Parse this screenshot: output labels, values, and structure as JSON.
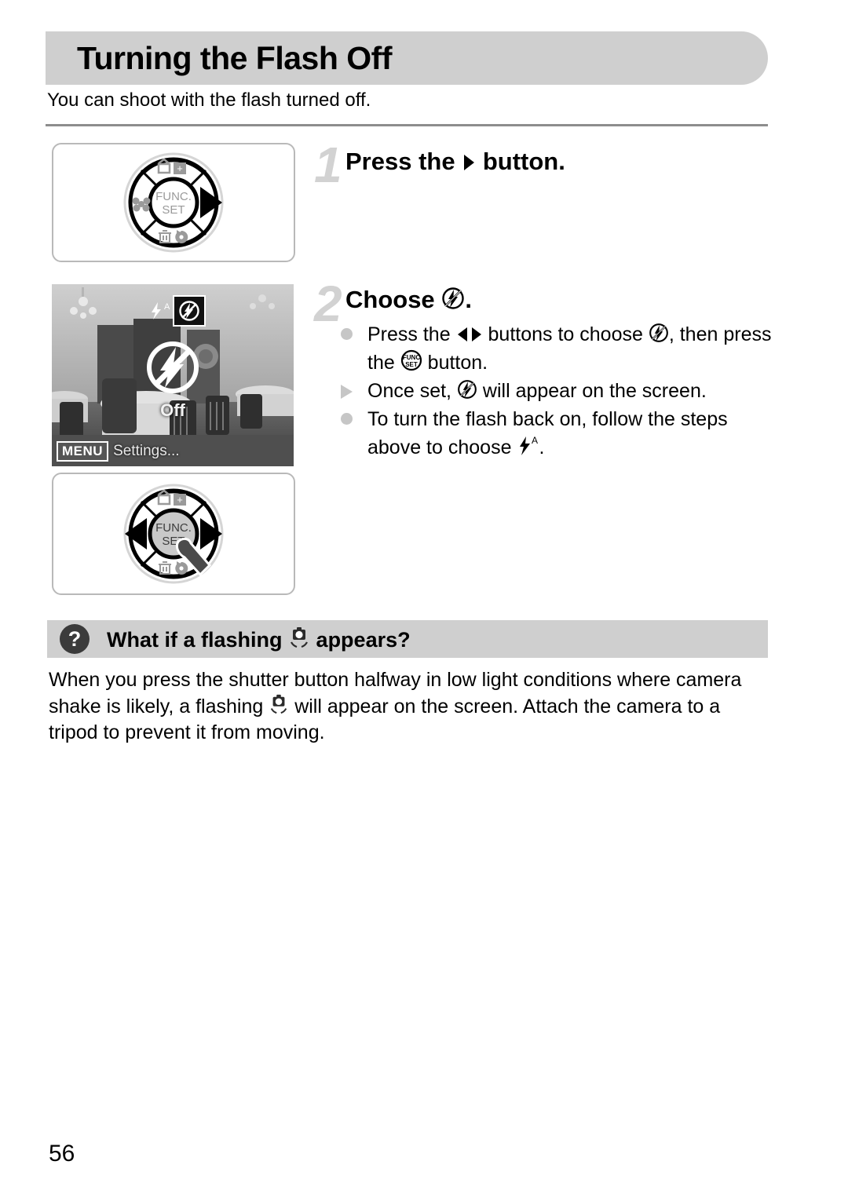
{
  "document": {
    "title": "Turning the Flash Off",
    "intro": "You can shoot with the flash turned off.",
    "page_number": "56"
  },
  "steps": [
    {
      "number": "1",
      "heading_before": "Press the",
      "heading_icon": "right-arrow-button-icon",
      "heading_after": "button."
    },
    {
      "number": "2",
      "heading_before": "Choose",
      "heading_icon": "flash-off-icon",
      "heading_after": "."
    }
  ],
  "bullets": [
    {
      "marker": "dot",
      "seg1": "Press the",
      "icon1": "left-right-buttons-icon",
      "seg2": "buttons to choose",
      "icon2": "flash-off-icon",
      "seg3": ", then press the",
      "icon3": "func-set-button-icon",
      "seg4": "button."
    },
    {
      "marker": "triangle",
      "seg1": "Once set,",
      "icon1": "flash-off-icon",
      "seg2": "will appear on the screen."
    },
    {
      "marker": "dot",
      "seg1": "To turn the flash back on, follow the steps above to choose",
      "icon1": "flash-auto-icon",
      "seg2": "."
    }
  ],
  "faq": {
    "question_mark": "?",
    "title_before": "What if a flashing",
    "title_icon": "camera-shake-icon",
    "title_after": "appears?",
    "body_before": "When you press the shutter button halfway in low light conditions where camera shake is likely, a flashing",
    "body_icon": "camera-shake-icon",
    "body_after": "will appear on the screen. Attach the camera to a tripod to prevent it from moving."
  },
  "illustrations": {
    "dial_one": {
      "name": "camera-control-dial-right-pressed",
      "center_label_top": "FUNC.",
      "center_label_bottom": "SET",
      "highlight": "right"
    },
    "dial_two": {
      "name": "camera-control-dial-left-right-pressed",
      "center_label_top": "FUNC.",
      "center_label_bottom": "SET",
      "highlight": "left-right"
    },
    "lcd": {
      "name": "camera-lcd-flash-off-selection",
      "option_auto": "flash-auto-icon",
      "option_off": "flash-off-icon",
      "status_label": "Off",
      "menu_chip": "MENU",
      "menu_label": "Settings..."
    }
  },
  "colors": {
    "bar_gray": "#cfcfcf",
    "step_number_gray": "#d2d2d2",
    "bullet_gray": "#c6c6c6",
    "rule_gray": "#8d8d8d"
  }
}
